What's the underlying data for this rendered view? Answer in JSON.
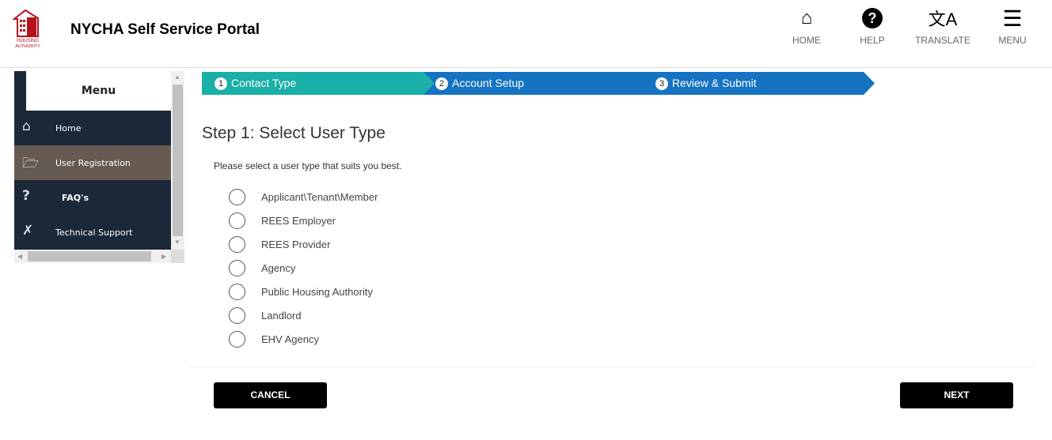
{
  "header": {
    "title": "NYCHA Self Service Portal",
    "logo_text": "NEW YORK CITY HOUSING AUTHORITY",
    "logo_color": "#b5121b",
    "nav": [
      {
        "label": "HOME",
        "icon": "home-icon"
      },
      {
        "label": "HELP",
        "icon": "question-circle-icon"
      },
      {
        "label": "TRANSLATE",
        "icon": "translate-icon"
      },
      {
        "label": "MENU",
        "icon": "hamburger-icon"
      }
    ]
  },
  "sidebar": {
    "title": "Menu",
    "items": [
      {
        "label": "Home",
        "icon": "home-icon"
      },
      {
        "label": "User Registration",
        "icon": "folder-check-icon",
        "active": true
      },
      {
        "label": "FAQ's",
        "icon": "question-icon"
      },
      {
        "label": "Technical Support",
        "icon": "tools-icon"
      }
    ],
    "bg": "#1b2838",
    "active_bg": "#675a51"
  },
  "steps": [
    {
      "num": "1",
      "label": "Contact Type",
      "active": true,
      "color": "#1aafa7"
    },
    {
      "num": "2",
      "label": "Account Setup",
      "color": "#1673c1"
    },
    {
      "num": "3",
      "label": "Review & Submit",
      "color": "#1673c1"
    }
  ],
  "main": {
    "heading": "Step 1: Select User Type",
    "prompt": "Please select a user type that suits you best.",
    "options": [
      "Applicant\\Tenant\\Member",
      "REES Employer",
      "REES Provider",
      "Agency",
      "Public Housing Authority",
      "Landlord",
      "EHV Agency"
    ]
  },
  "buttons": {
    "cancel": "CANCEL",
    "next": "NEXT"
  }
}
